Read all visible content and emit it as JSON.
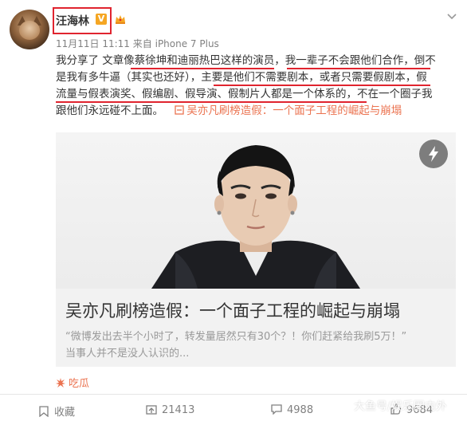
{
  "header": {
    "user_name": "汪海林",
    "verified_badge": "V",
    "timestamp": "11月11日 11:11",
    "source_prefix": "来自",
    "device": "iPhone 7 Plus"
  },
  "post": {
    "lines": [
      "我分享了 文章像蔡徐坤和迪丽热巴这样的演员，我一辈子不会跟他们合作，倒不",
      "是我有多牛逼（其实也还好），主要是他们不需要剧本，或者只需要假剧本，假",
      "流量与假表演奖、假编剧、假导演、假制片人都是一个体系的，不在一个圈子我",
      "跟他们永远碰不上面。"
    ],
    "link_text": "吴亦凡刷榜造假：一个面子工程的崛起与崩塌"
  },
  "card": {
    "title": "吴亦凡刷榜造假：一个面子工程的崛起与崩塌",
    "desc_lines": [
      "“微博发出去半个小时了，转发量居然只有30个？！你们赶紧给我刷5万！”",
      "当事人并不是没人认识的..."
    ]
  },
  "source": {
    "label": "吃瓜"
  },
  "actions": {
    "favorite": "收藏",
    "repost": "21413",
    "comment": "4988",
    "like": "9684"
  },
  "watermark": "大鱼号/娱乐圈内外",
  "colors": {
    "highlight_red": "#e0242f",
    "link_orange": "#eb7350",
    "badge_orange": "#f5a623",
    "muted_text": "#808080"
  },
  "icons": [
    "crown-icon",
    "chevron-down-icon",
    "link-icon",
    "lightning-icon",
    "source-icon",
    "favorite-icon",
    "repost-icon",
    "comment-icon",
    "like-icon"
  ]
}
